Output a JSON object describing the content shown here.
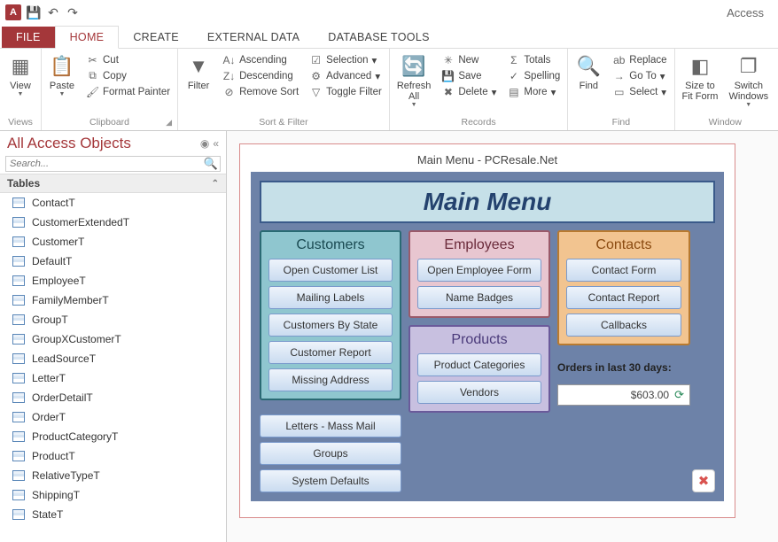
{
  "app_title": "Access",
  "tabs": {
    "file": "FILE",
    "home": "HOME",
    "create": "CREATE",
    "external": "EXTERNAL DATA",
    "dbtools": "DATABASE TOOLS"
  },
  "ribbon": {
    "views": {
      "view": "View",
      "label": "Views"
    },
    "clipboard": {
      "paste": "Paste",
      "cut": "Cut",
      "copy": "Copy",
      "fpainter": "Format Painter",
      "label": "Clipboard"
    },
    "sortfilter": {
      "filter": "Filter",
      "asc": "Ascending",
      "desc": "Descending",
      "remove": "Remove Sort",
      "selection": "Selection",
      "advanced": "Advanced",
      "toggle": "Toggle Filter",
      "label": "Sort & Filter"
    },
    "records": {
      "refresh": "Refresh\nAll",
      "new": "New",
      "save": "Save",
      "delete": "Delete",
      "totals": "Totals",
      "spelling": "Spelling",
      "more": "More",
      "label": "Records"
    },
    "find": {
      "find": "Find",
      "replace": "Replace",
      "goto": "Go To",
      "select": "Select",
      "label": "Find"
    },
    "window": {
      "size": "Size to\nFit Form",
      "switch": "Switch\nWindows",
      "label": "Window"
    }
  },
  "nav": {
    "title": "All Access Objects",
    "search_placeholder": "Search...",
    "tables_header": "Tables",
    "items": [
      "ContactT",
      "CustomerExtendedT",
      "CustomerT",
      "DefaultT",
      "EmployeeT",
      "FamilyMemberT",
      "GroupT",
      "GroupXCustomerT",
      "LeadSourceT",
      "LetterT",
      "OrderDetailT",
      "OrderT",
      "ProductCategoryT",
      "ProductT",
      "RelativeTypeT",
      "ShippingT",
      "StateT"
    ]
  },
  "form": {
    "window_title": "Main Menu - PCResale.Net",
    "main_header": "Main Menu",
    "customers": {
      "title": "Customers",
      "btns": [
        "Open Customer List",
        "Mailing Labels",
        "Customers By State",
        "Customer Report",
        "Missing Address"
      ]
    },
    "employees": {
      "title": "Employees",
      "btns": [
        "Open Employee Form",
        "Name Badges"
      ]
    },
    "contacts": {
      "title": "Contacts",
      "btns": [
        "Contact Form",
        "Contact Report",
        "Callbacks"
      ]
    },
    "products": {
      "title": "Products",
      "btns": [
        "Product Categories",
        "Vendors"
      ]
    },
    "extra_btns": [
      "Letters - Mass Mail",
      "Groups",
      "System Defaults"
    ],
    "orders_label": "Orders in last 30 days:",
    "orders_value": "$603.00"
  }
}
